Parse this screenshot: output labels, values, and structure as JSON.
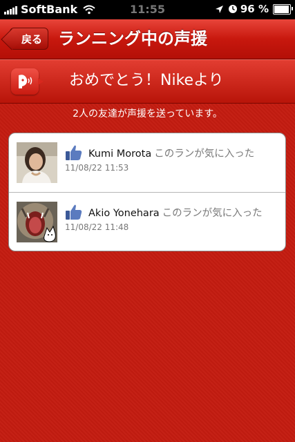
{
  "status_bar": {
    "carrier": "SoftBank",
    "time": "11:55",
    "battery_percent": "96 %"
  },
  "navbar": {
    "back_label": "戻る",
    "title": "ランニング中の声援"
  },
  "cheer": {
    "message": "おめでとう！Nikeより"
  },
  "subtitle": "2人の友達が声援を送っています。",
  "cheers": [
    {
      "name": "Kumi Morota",
      "action": "このランが気に入った",
      "time": "11/08/22  11:53"
    },
    {
      "name": "Akio Yonehara",
      "action": "このランが気に入った",
      "time": "11/08/22  11:48"
    }
  ]
}
